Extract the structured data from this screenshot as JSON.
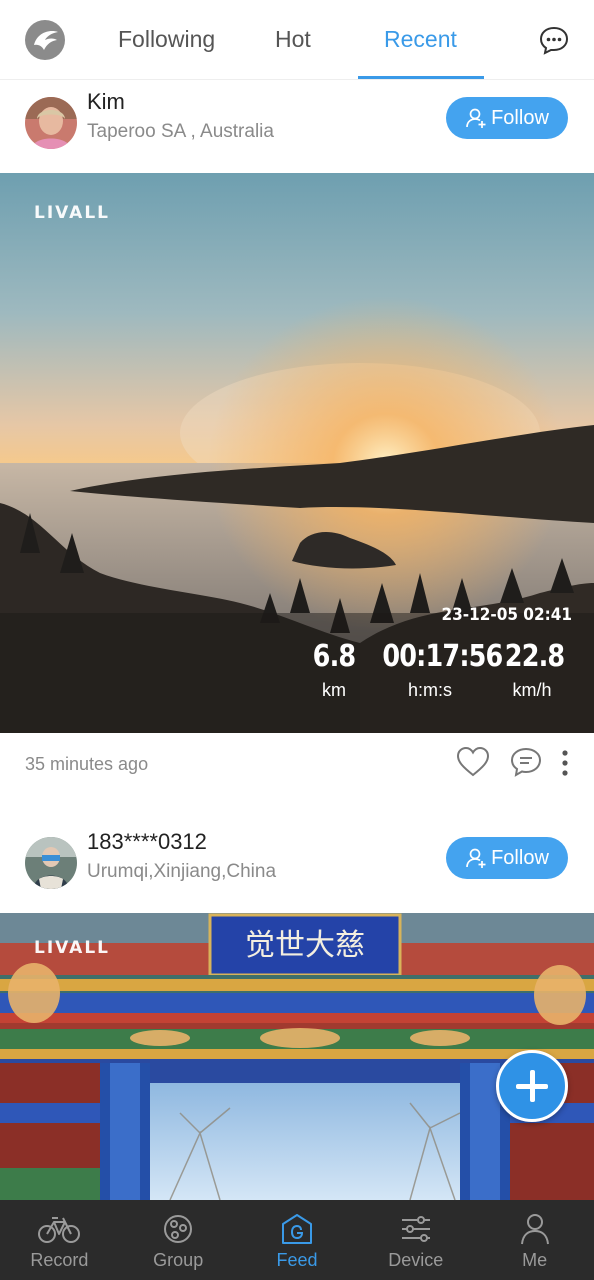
{
  "header": {
    "tabs": [
      {
        "label": "Following",
        "active": false
      },
      {
        "label": "Hot",
        "active": false
      },
      {
        "label": "Recent",
        "active": true
      }
    ],
    "icons": {
      "logo": "livall-logo-icon",
      "messages": "chat-bubble-icon"
    }
  },
  "posts": [
    {
      "user": "Kim",
      "location": "Taperoo SA , Australia",
      "follow_label": "Follow",
      "watermark": "LIVALL",
      "ride": {
        "datetime": "23-12-05  02:41",
        "distance": "6.8",
        "distance_unit": "km",
        "duration": "00:17:56",
        "duration_unit": "h:m:s",
        "speed": "22.8",
        "speed_unit": "km/h"
      },
      "time_ago": "35 minutes ago"
    },
    {
      "user": "183****0312",
      "location": "Urumqi,Xinjiang,China",
      "follow_label": "Follow",
      "watermark": "LIVALL",
      "sign_text": "觉世大慈"
    }
  ],
  "fab": {
    "icon": "plus-icon"
  },
  "nav": [
    {
      "label": "Record",
      "icon": "bicycle-icon",
      "active": false
    },
    {
      "label": "Group",
      "icon": "group-icon",
      "active": false
    },
    {
      "label": "Feed",
      "icon": "feed-icon",
      "active": true
    },
    {
      "label": "Device",
      "icon": "sliders-icon",
      "active": false
    },
    {
      "label": "Me",
      "icon": "person-icon",
      "active": false
    }
  ],
  "colors": {
    "accent": "#3a9ae8",
    "follow_button": "#44a3ef",
    "nav_background": "#2b2b2b"
  }
}
